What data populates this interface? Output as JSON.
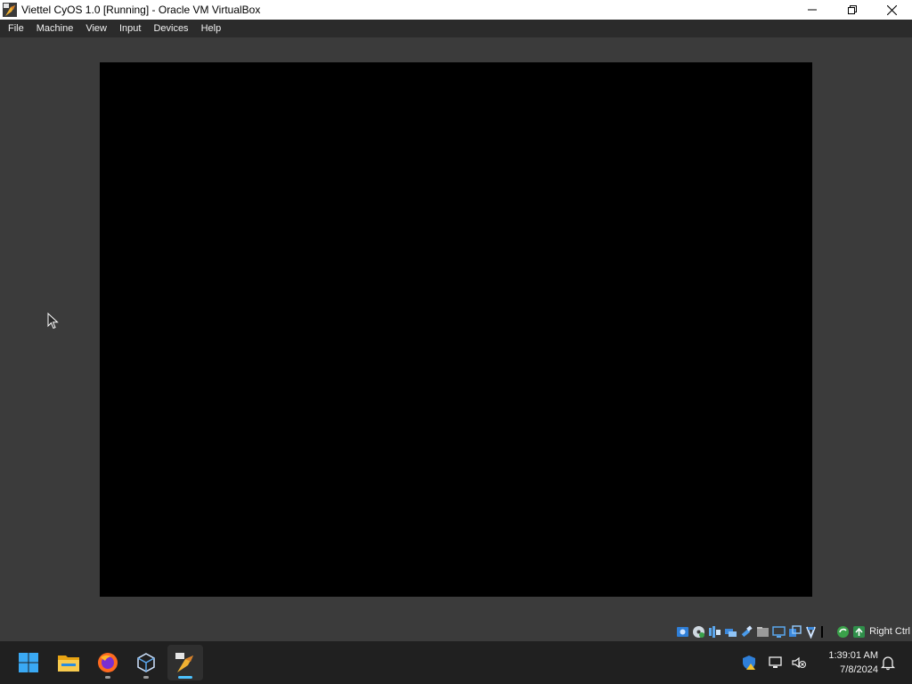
{
  "window": {
    "title": "Viettel CyOS 1.0 [Running] - Oracle VM VirtualBox"
  },
  "menu": {
    "items": [
      {
        "label": "File"
      },
      {
        "label": "Machine"
      },
      {
        "label": "View"
      },
      {
        "label": "Input"
      },
      {
        "label": "Devices"
      },
      {
        "label": "Help"
      }
    ]
  },
  "status_bar": {
    "icons": [
      "hard-disk-icon",
      "optical-drive-icon",
      "audio-icon",
      "network-icon",
      "usb-icon",
      "shared-folders-icon",
      "display-icon",
      "video-capture-icon",
      "recording-icon",
      "cpu-icon",
      "mouse-integration-icon",
      "keyboard-icon"
    ],
    "host_key": "Right Ctrl"
  },
  "taskbar": {
    "apps": [
      "start-icon",
      "file-explorer-icon",
      "firefox-icon",
      "virtualbox-manager-icon",
      "virtualbox-vm-icon"
    ],
    "time": "1:39:01 AM",
    "date": "7/8/2024"
  },
  "colors": {
    "vm_background": "#3b3b3b",
    "guest_screen": "#000000",
    "taskbar": "#202020",
    "accent": "#4cc2ff"
  }
}
